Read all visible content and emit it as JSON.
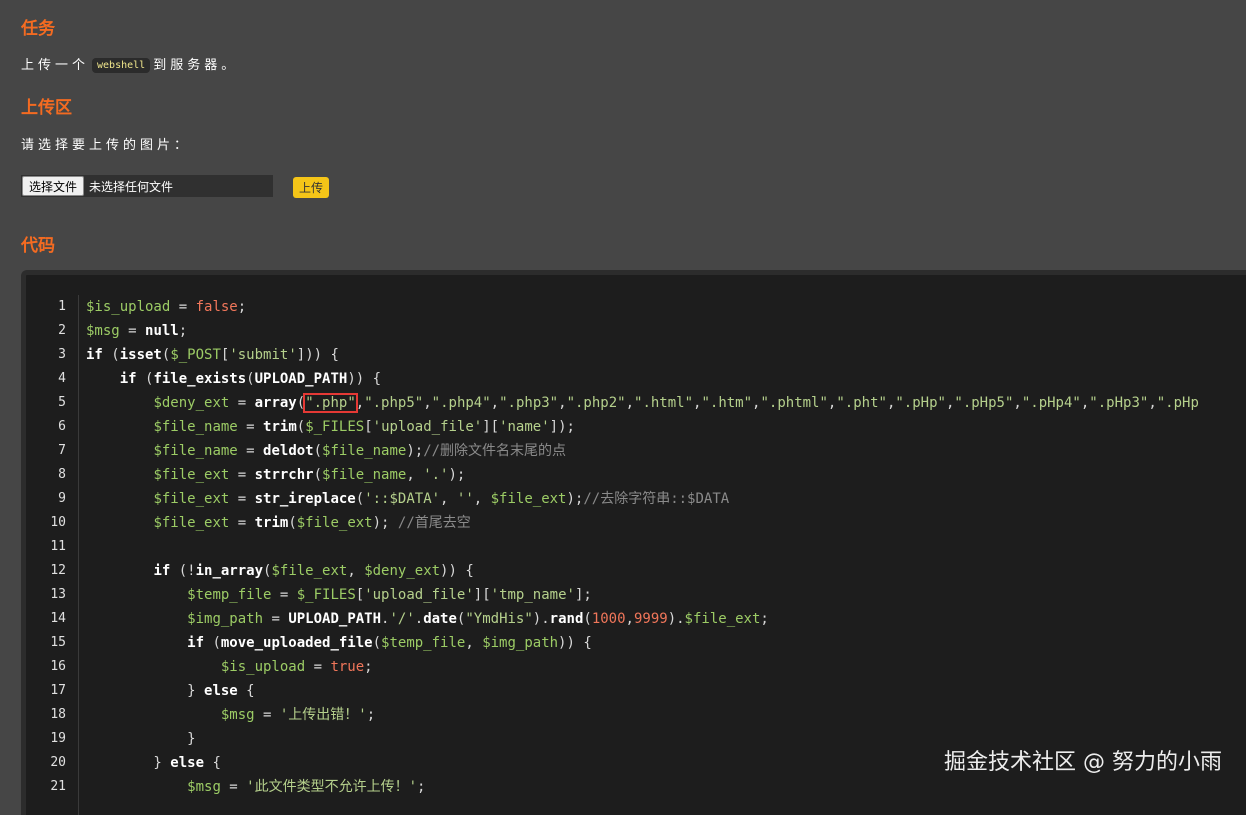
{
  "task": {
    "heading": "任务",
    "text_before": "上传一个",
    "inline_code": "webshell",
    "text_after": "到服务器。"
  },
  "upload": {
    "heading": "上传区",
    "prompt": "请选择要上传的图片：",
    "choose_button": "选择文件",
    "no_file_text": "未选择任何文件",
    "submit_button": "上传"
  },
  "code": {
    "heading": "代码",
    "line_numbers": [
      "1",
      "2",
      "3",
      "4",
      "5",
      "6",
      "7",
      "8",
      "9",
      "10",
      "11",
      "12",
      "13",
      "14",
      "15",
      "16",
      "17",
      "18",
      "19",
      "20",
      "21"
    ]
  },
  "watermark": "掘金技术社区 @ 努力的小雨",
  "colors": {
    "heading": "#f46b21",
    "highlight_box": "#e53935",
    "upload_button": "#f5c518"
  }
}
